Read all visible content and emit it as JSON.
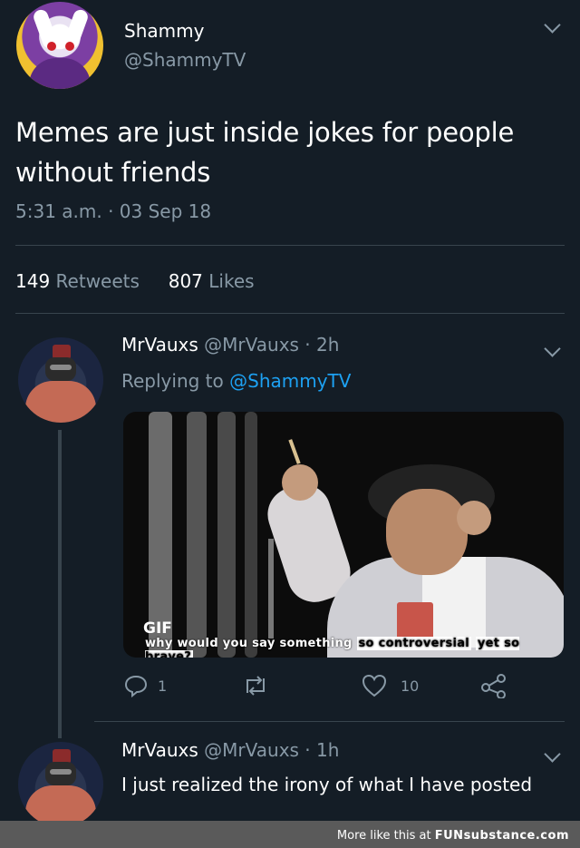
{
  "main_tweet": {
    "display_name": "Shammy",
    "handle": "@ShammyTV",
    "text": "Memes are just inside jokes for people without friends",
    "timestamp": "5:31 a.m. · 03 Sep 18",
    "retweets_count": "149",
    "retweets_label": "Retweets",
    "likes_count": "807",
    "likes_label": "Likes"
  },
  "replies": [
    {
      "display_name": "MrVauxs",
      "handle_time": "@MrVauxs · 2h",
      "replying_prefix": "Replying to",
      "replying_handle": "@ShammyTV",
      "gif_badge": "GIF",
      "gif_caption_1": "why would you say something",
      "gif_caption_hl_1": "so controversial",
      "gif_caption_hl_2": "yet so brave?",
      "reply_count": "1",
      "like_count": "10"
    },
    {
      "display_name": "MrVauxs",
      "handle_time": "@MrVauxs · 1h",
      "text": "I just realized the irony of what I have posted"
    }
  ],
  "footer": {
    "prefix": "More like this at",
    "brand": "FUNsubstance.com"
  },
  "icons": [
    "chevron-down-icon",
    "reply-icon",
    "retweet-icon",
    "heart-icon",
    "share-icon"
  ],
  "colors": {
    "background": "#141d26",
    "muted": "#8899a6",
    "link": "#1da1f2",
    "divider": "#38444d"
  }
}
